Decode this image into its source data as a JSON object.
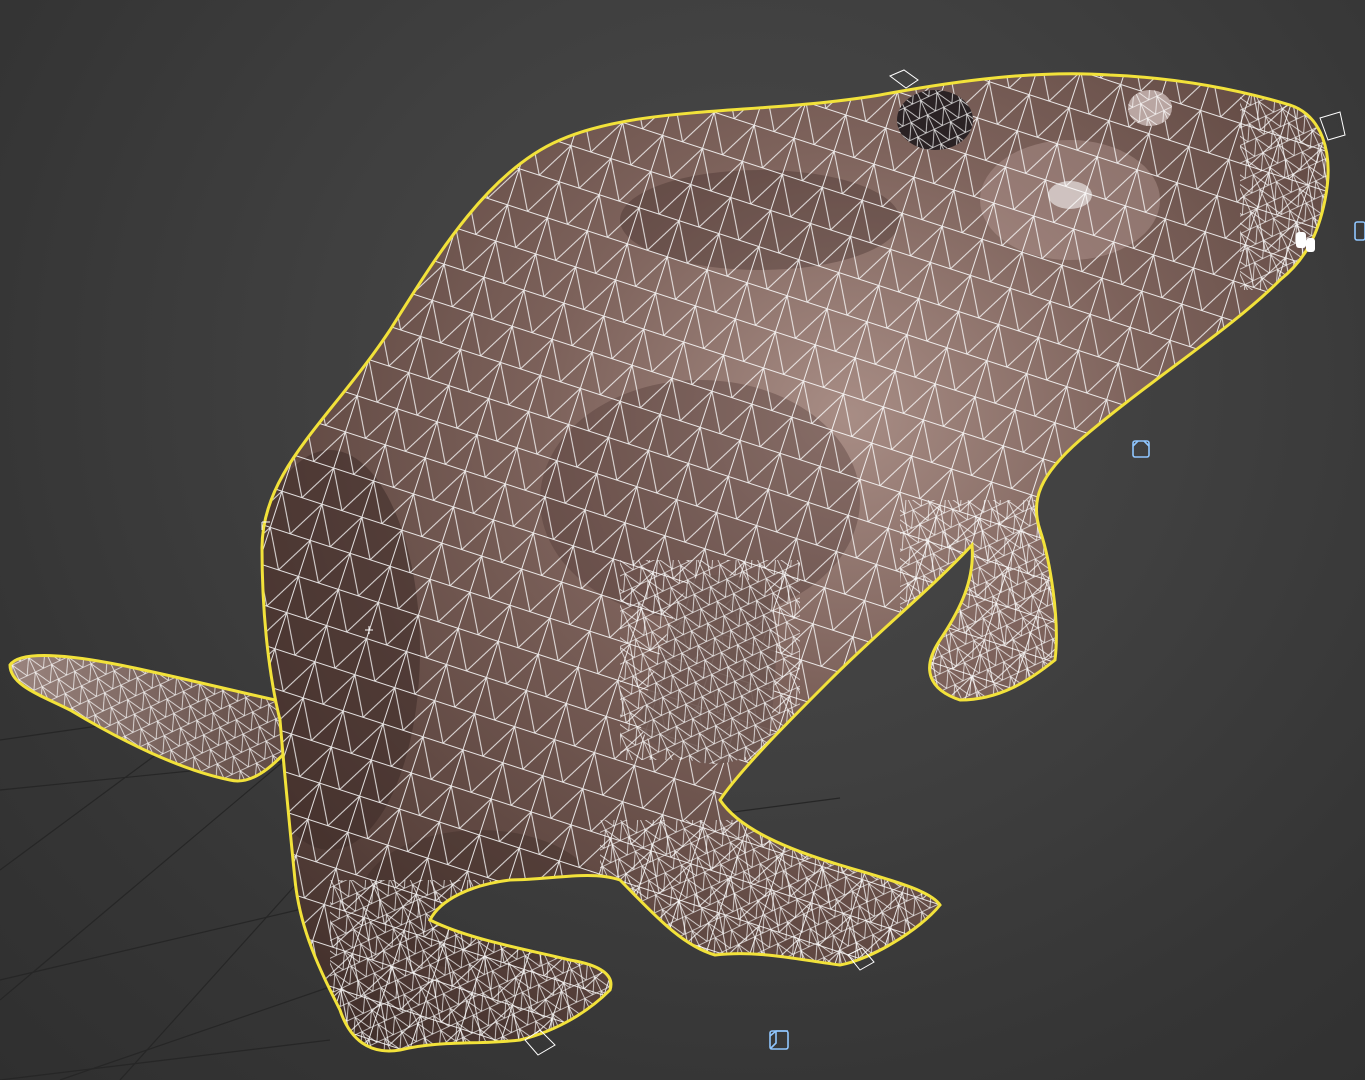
{
  "viewport": {
    "background_color": "#3b3b3b",
    "grid_color": "#2a2a2a",
    "selection_outline_color": "#f2e23a",
    "wireframe_color": "#ffffff",
    "helper_color": "#8fc6ff",
    "model_base_color": "#6e5650",
    "model_shadow_color": "#3e2c28",
    "model_highlight_color": "#a88d85"
  },
  "scene": {
    "selected_object": "beaver-model",
    "shading_mode": "textured-with-wireframe",
    "helper_icons": [
      "helper-box-icon",
      "helper-box-icon",
      "helper-box-icon"
    ]
  }
}
